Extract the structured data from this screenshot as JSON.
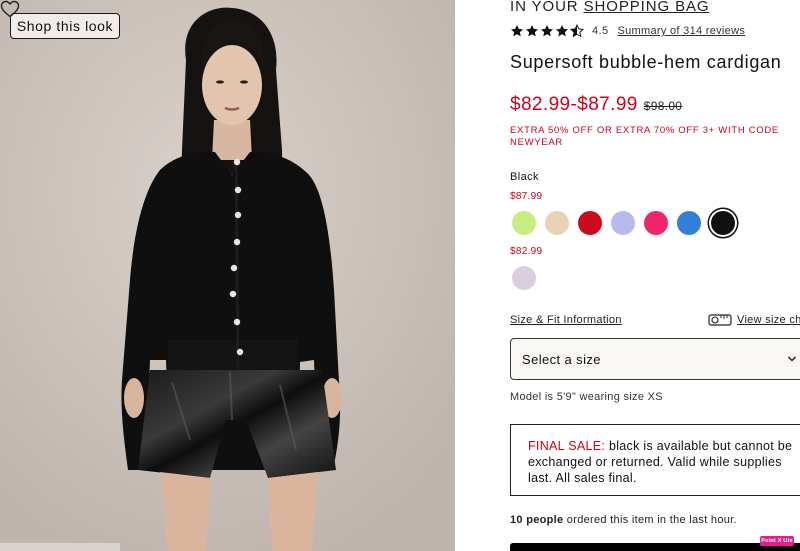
{
  "photo": {
    "shop_look_label": "Shop this look",
    "favorite_icon": "heart-outline-icon",
    "alt": "Model wearing black bubble-hem cardigan with black patent shorts"
  },
  "shopping_bag": {
    "prefix": "IN YOUR",
    "link": "SHOPPING BAG"
  },
  "rating": {
    "value": "4.5",
    "stars": 4.5,
    "reviews_link": "Summary of 314 reviews"
  },
  "product": {
    "title": "Supersoft bubble-hem cardigan",
    "price": "$82.99-$87.99",
    "original_price": "$98.00",
    "promo": "EXTRA 50% OFF OR EXTRA 70% OFF 3+ WITH CODE NEWYEAR"
  },
  "colors": {
    "selected_name": "Black",
    "groups": [
      {
        "price": "$87.99",
        "swatches": [
          {
            "name": "lime",
            "color": "#c9ec80",
            "selected": false
          },
          {
            "name": "beige",
            "color": "#e8d1b5",
            "selected": false
          },
          {
            "name": "red",
            "color": "#cc0a1e",
            "selected": false
          },
          {
            "name": "periwinkle",
            "color": "#b9b9ee",
            "selected": false
          },
          {
            "name": "hot-pink",
            "color": "#f2236d",
            "selected": false
          },
          {
            "name": "blue",
            "color": "#2f80d6",
            "selected": false
          },
          {
            "name": "black",
            "color": "#111111",
            "selected": true
          }
        ]
      },
      {
        "price": "$82.99",
        "swatches": [
          {
            "name": "lilac",
            "color": "#ddcde0",
            "selected": false
          }
        ]
      }
    ]
  },
  "size": {
    "fit_link": "Size & Fit Information",
    "chart_link": "View size cha",
    "chart_icon": "tape-measure-icon",
    "select_placeholder": "Select a size",
    "model_note": "Model is 5'9\" wearing size XS"
  },
  "final_sale": {
    "label": "FINAL SALE:",
    "text": " black is available but cannot be exchanged or returned. Valid while supplies last. All sales final."
  },
  "social_proof": {
    "count": "10 people",
    "text": " ordered this item in the last hour."
  },
  "badge": {
    "label": "Point X Ute"
  }
}
